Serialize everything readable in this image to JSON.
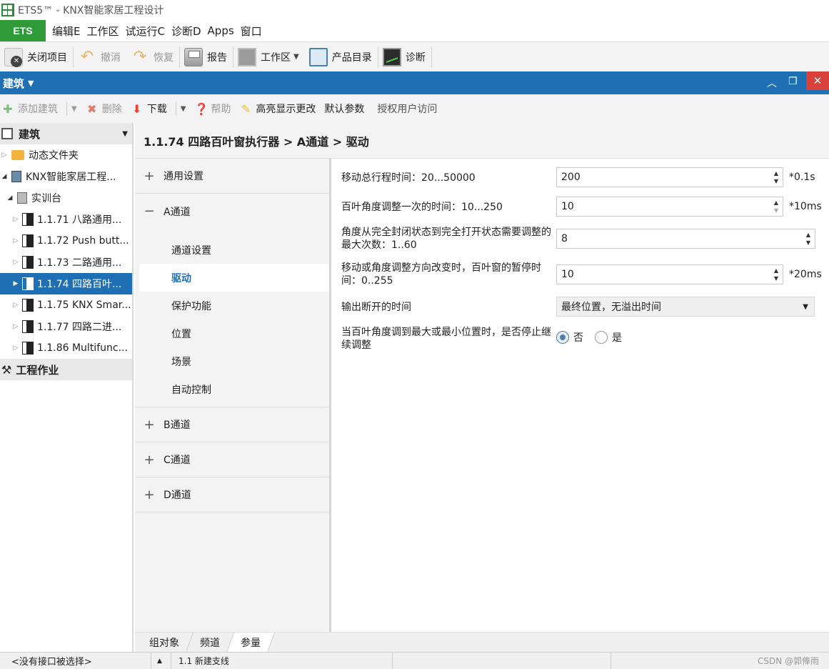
{
  "window": {
    "title": "ETS5™ - KNX智能家居工程设计"
  },
  "menu": {
    "ets": "ETS",
    "items": [
      "编辑E",
      "工作区",
      "试运行C",
      "诊断D",
      "Apps",
      "窗口"
    ]
  },
  "toolbar": {
    "close_project": "关闭项目",
    "undo": "撤消",
    "redo": "恢复",
    "report": "报告",
    "workspace": "工作区",
    "catalog": "产品目录",
    "diagnose": "诊断"
  },
  "panel": {
    "title": "建筑",
    "close": "✕"
  },
  "subtoolbar": {
    "add_building": "添加建筑",
    "delete": "删除",
    "download": "下载",
    "help": "帮助",
    "highlight": "高亮显示更改",
    "default_params": "默认参数",
    "authorize": "授权用户访问"
  },
  "tree": {
    "header": "建筑",
    "rows": [
      "动态文件夹",
      "KNX智能家居工程...",
      "实训台",
      "1.1.71 八路通用...",
      "1.1.72 Push butt...",
      "1.1.73 二路通用...",
      "1.1.74 四路百叶...",
      "1.1.75 KNX Smar...",
      "1.1.77 四路二进...",
      "1.1.86 Multifunc..."
    ],
    "footer": "工程作业"
  },
  "breadcrumb": "1.1.74 四路百叶窗执行器 > A通道 > 驱动",
  "nav": {
    "general": "通用设置",
    "channel_a": "A通道",
    "sub": [
      "通道设置",
      "驱动",
      "保护功能",
      "位置",
      "场景",
      "自动控制"
    ],
    "channel_b": "B通道",
    "channel_c": "C通道",
    "channel_d": "D通道"
  },
  "params": {
    "p1": {
      "label": "移动总行程时间：20...50000",
      "value": "200",
      "unit": "*0.1s"
    },
    "p2": {
      "label": "百叶角度调整一次的时间：10...250",
      "value": "10",
      "unit": "*10ms"
    },
    "p3": {
      "label": "角度从完全封闭状态到完全打开状态需要调整的最大次数：1..60",
      "value": "8"
    },
    "p4": {
      "label": "移动或角度调整方向改变时，百叶窗的暂停时间：0..255",
      "value": "10",
      "unit": "*20ms"
    },
    "p5": {
      "label": "输出断开的时间",
      "value": "最终位置，无溢出时间"
    },
    "p6": {
      "label": "当百叶角度调到最大或最小位置时，是否停止继续调整",
      "opt_no": "否",
      "opt_yes": "是"
    }
  },
  "bottom_tabs": [
    "组对象",
    "频道",
    "参量"
  ],
  "status": {
    "interface": "<没有接口被选择>",
    "line": "1.1 新建支线",
    "watermark": "CSDN @郭俸雨"
  }
}
